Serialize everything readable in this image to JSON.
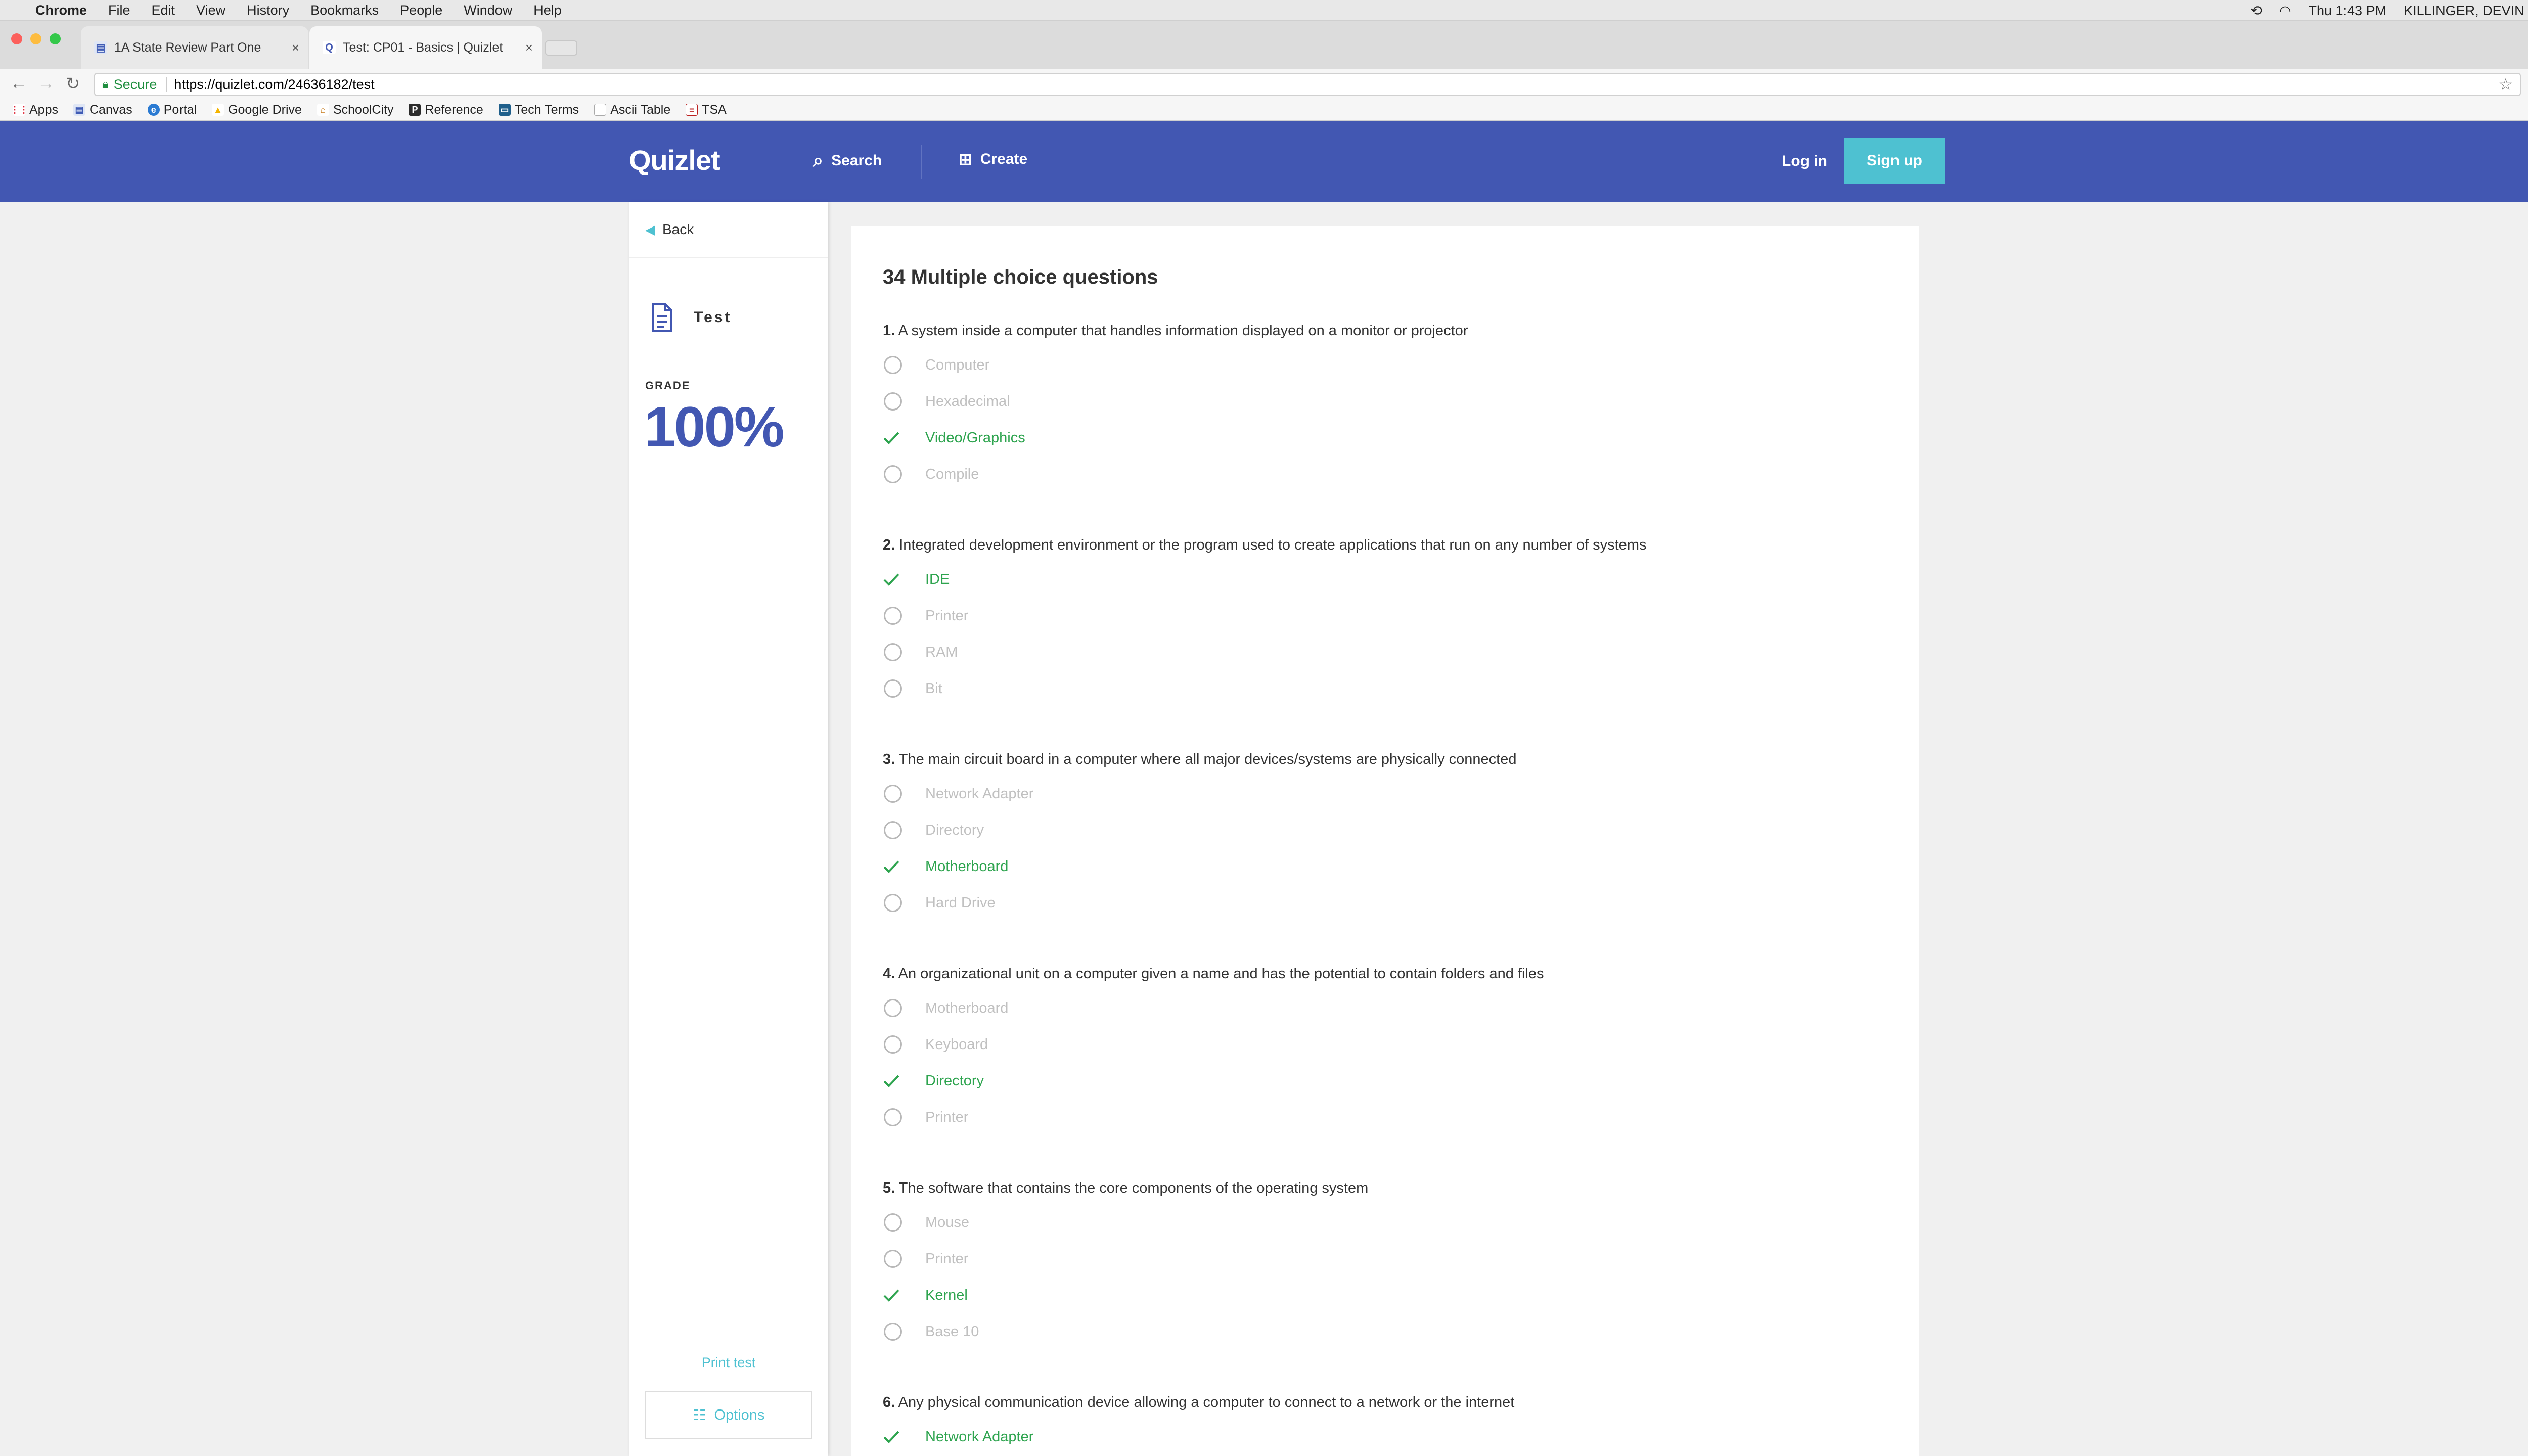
{
  "menubar": {
    "app": "Chrome",
    "items": [
      "File",
      "Edit",
      "View",
      "History",
      "Bookmarks",
      "People",
      "Window",
      "Help"
    ],
    "clock": "Thu 1:43 PM",
    "user": "KILLINGER, DEVIN"
  },
  "tabs": [
    {
      "title": "1A State Review Part One"
    },
    {
      "title": "Test: CP01 - Basics | Quizlet"
    }
  ],
  "address": {
    "secure_label": "Secure",
    "url": "https://quizlet.com/24636182/test"
  },
  "bookmarks": [
    "Apps",
    "Canvas",
    "Portal",
    "Google Drive",
    "SchoolCity",
    "Reference",
    "Tech Terms",
    "Ascii Table",
    "TSA"
  ],
  "header": {
    "logo": "Quizlet",
    "search": "Search",
    "create": "Create",
    "login": "Log in",
    "signup": "Sign up"
  },
  "sidebar": {
    "back": "Back",
    "mode": "Test",
    "grade_label": "GRADE",
    "grade": "100%",
    "print": "Print test",
    "options": "Options"
  },
  "main": {
    "heading": "34 Multiple choice questions",
    "questions": [
      {
        "num": "1.",
        "text": "A system inside a computer that handles information displayed on a monitor or projector",
        "answers": [
          {
            "label": "Computer",
            "correct": false
          },
          {
            "label": "Hexadecimal",
            "correct": false
          },
          {
            "label": "Video/Graphics",
            "correct": true
          },
          {
            "label": "Compile",
            "correct": false
          }
        ]
      },
      {
        "num": "2.",
        "text": "Integrated development environment or the program used to create applications that run on any number of systems",
        "answers": [
          {
            "label": "IDE",
            "correct": true
          },
          {
            "label": "Printer",
            "correct": false
          },
          {
            "label": "RAM",
            "correct": false
          },
          {
            "label": "Bit",
            "correct": false
          }
        ]
      },
      {
        "num": "3.",
        "text": "The main circuit board in a computer where all major devices/systems are physically connected",
        "answers": [
          {
            "label": "Network Adapter",
            "correct": false
          },
          {
            "label": "Directory",
            "correct": false
          },
          {
            "label": "Motherboard",
            "correct": true
          },
          {
            "label": "Hard Drive",
            "correct": false
          }
        ]
      },
      {
        "num": "4.",
        "text": "An organizational unit on a computer given a name and has the potential to contain folders and files",
        "answers": [
          {
            "label": "Motherboard",
            "correct": false
          },
          {
            "label": "Keyboard",
            "correct": false
          },
          {
            "label": "Directory",
            "correct": true
          },
          {
            "label": "Printer",
            "correct": false
          }
        ]
      },
      {
        "num": "5.",
        "text": "The software that contains the core components of the operating system",
        "answers": [
          {
            "label": "Mouse",
            "correct": false
          },
          {
            "label": "Printer",
            "correct": false
          },
          {
            "label": "Kernel",
            "correct": true
          },
          {
            "label": "Base 10",
            "correct": false
          }
        ]
      },
      {
        "num": "6.",
        "text": "Any physical communication device allowing a computer to connect to a network or the internet",
        "answers": [
          {
            "label": "Network Adapter",
            "correct": true
          }
        ]
      }
    ]
  },
  "colors": {
    "header": "#4257b2",
    "accent": "#4ec1d1",
    "correct": "#2ea44f",
    "incorrect_text": "#c0c0c0"
  }
}
